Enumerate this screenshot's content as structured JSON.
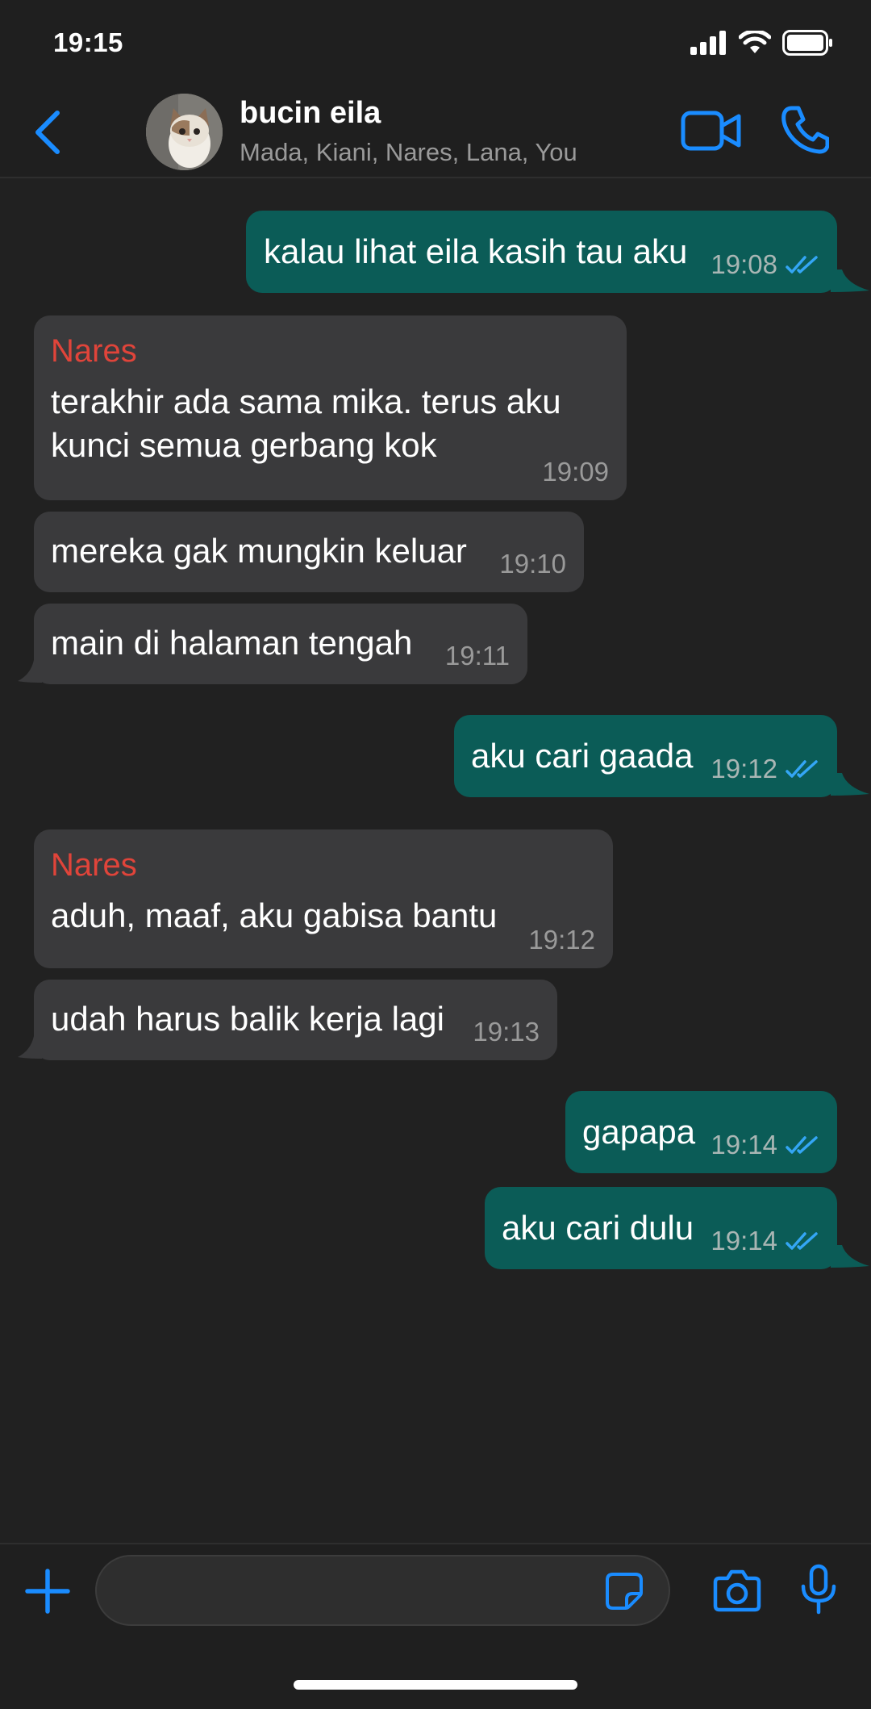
{
  "status_bar": {
    "time": "19:15"
  },
  "header": {
    "title": "bucin eila",
    "members": "Mada, Kiani, Nares, Lana, You"
  },
  "messages": [
    {
      "direction": "out",
      "text": "kalau lihat eila kasih tau aku",
      "time": "19:08",
      "read": true
    },
    {
      "direction": "in",
      "sender": "Nares",
      "text": "terakhir ada sama mika. terus aku kunci semua gerbang kok",
      "time": "19:09"
    },
    {
      "direction": "in",
      "text": "mereka gak mungkin keluar",
      "time": "19:10"
    },
    {
      "direction": "in",
      "text": "main di halaman tengah",
      "time": "19:11"
    },
    {
      "direction": "out",
      "text": "aku cari gaada",
      "time": "19:12",
      "read": true
    },
    {
      "direction": "in",
      "sender": "Nares",
      "text": "aduh, maaf, aku gabisa bantu",
      "time": "19:12"
    },
    {
      "direction": "in",
      "text": "udah harus balik kerja lagi",
      "time": "19:13"
    },
    {
      "direction": "out",
      "text": "gapapa",
      "time": "19:14",
      "read": true
    },
    {
      "direction": "out",
      "text": "aku cari dulu",
      "time": "19:14",
      "read": true
    }
  ],
  "composer": {
    "value": ""
  },
  "icons": {
    "back": "chevron-left-icon",
    "video": "video-camera-icon",
    "call": "phone-icon",
    "plus": "plus-icon",
    "sticker": "sticker-icon",
    "camera": "camera-icon",
    "mic": "microphone-icon",
    "read": "double-check-icon"
  },
  "colors": {
    "accent": "#1a8cff",
    "outgoing_bubble": "#0b5c57",
    "incoming_bubble": "#3a3a3c",
    "sender_name": "#e0443a",
    "read_check": "#34a6f5"
  }
}
